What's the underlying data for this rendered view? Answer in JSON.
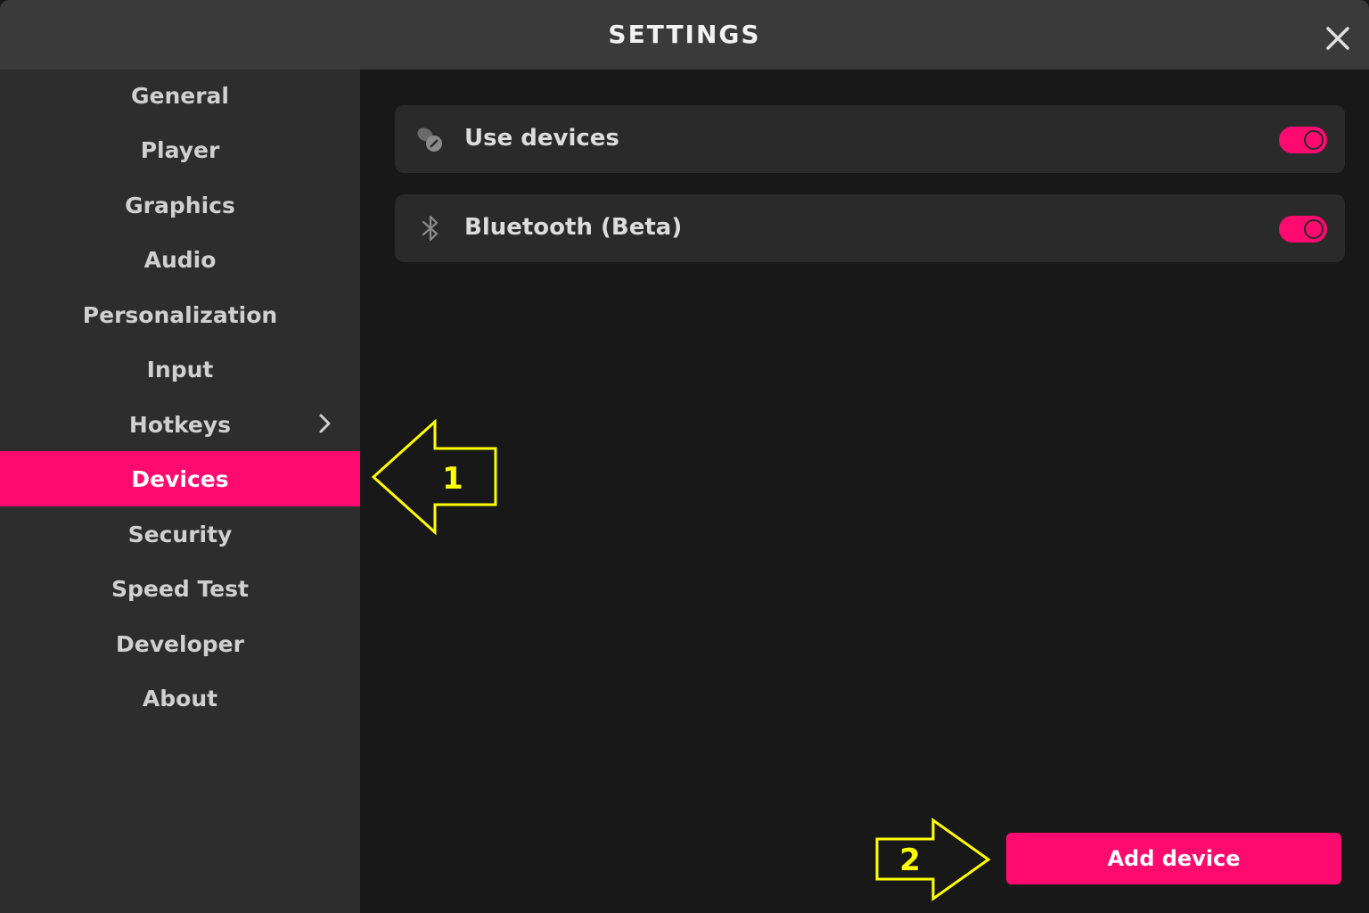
{
  "window": {
    "title": "SETTINGS"
  },
  "sidebar": {
    "items": [
      {
        "label": "General"
      },
      {
        "label": "Player"
      },
      {
        "label": "Graphics"
      },
      {
        "label": "Audio"
      },
      {
        "label": "Personalization"
      },
      {
        "label": "Input"
      },
      {
        "label": "Hotkeys",
        "has_submenu": true
      },
      {
        "label": "Devices",
        "active": true
      },
      {
        "label": "Security"
      },
      {
        "label": "Speed Test"
      },
      {
        "label": "Developer"
      },
      {
        "label": "About"
      }
    ]
  },
  "main": {
    "settings": [
      {
        "label": "Use devices",
        "icon": "devices-icon",
        "enabled": true
      },
      {
        "label": "Bluetooth (Beta)",
        "icon": "bluetooth-icon",
        "enabled": true
      }
    ],
    "add_button_label": "Add device"
  },
  "annotations": [
    {
      "label": "1",
      "direction": "left",
      "color": "#ffff00"
    },
    {
      "label": "2",
      "direction": "right",
      "color": "#ffff00"
    }
  ],
  "colors": {
    "accent": "#ff0a6e",
    "annotation": "#ffff00"
  }
}
